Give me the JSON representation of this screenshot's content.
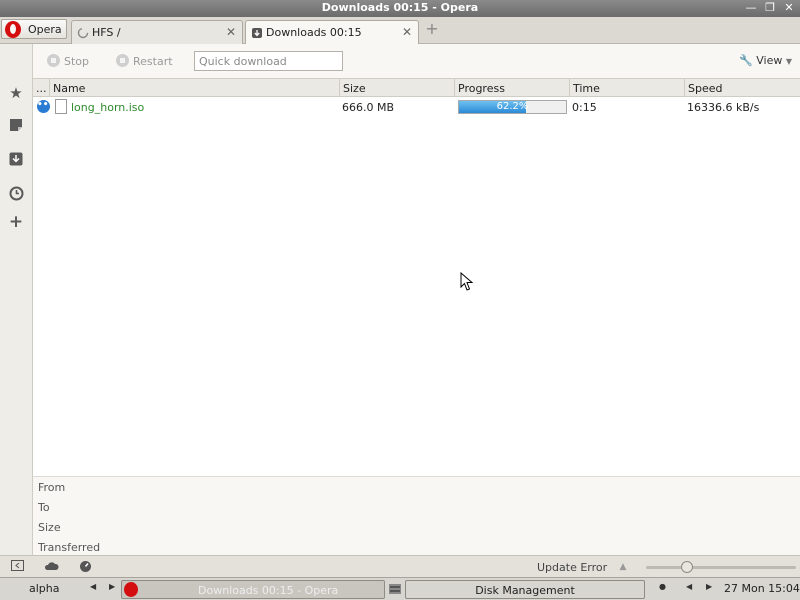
{
  "window": {
    "title": "Downloads 00:15 - Opera",
    "controls": [
      "minimize-icon",
      "restore-icon",
      "close-icon"
    ]
  },
  "tabs": {
    "opera_button": "Opera",
    "items": [
      {
        "label": "HFS /",
        "icon": "loading-icon"
      },
      {
        "label": "Downloads 00:15",
        "icon": "download-icon",
        "active": true
      }
    ]
  },
  "sidebar": {
    "items": [
      "star-icon",
      "notes-icon",
      "downloads-icon",
      "history-icon",
      "add-icon"
    ]
  },
  "toolbar": {
    "stop": "Stop",
    "restart": "Restart",
    "quick_placeholder": "Quick download",
    "view": "View"
  },
  "table": {
    "columns": [
      "...",
      "Name",
      "Size",
      "Progress",
      "Time",
      "Speed"
    ],
    "rows": [
      {
        "name": "long_horn.iso",
        "size": "666.0 MB",
        "progress_text": "62.2%",
        "progress_value": 0.622,
        "time": "0:15",
        "speed": "16336.6 kB/s"
      }
    ]
  },
  "details": {
    "from": "From",
    "to": "To",
    "size": "Size",
    "transferred": "Transferred"
  },
  "statusbar": {
    "update": "Update Error"
  },
  "taskbar": {
    "workspace": "alpha",
    "task_opera": "Downloads 00:15 - Opera",
    "task_disk": "Disk Management",
    "clock": "27 Mon 15:04"
  },
  "colors": {
    "accent": "#2b8ad6",
    "filename": "#2e8b2e",
    "opera_red": "#d40e0e"
  }
}
